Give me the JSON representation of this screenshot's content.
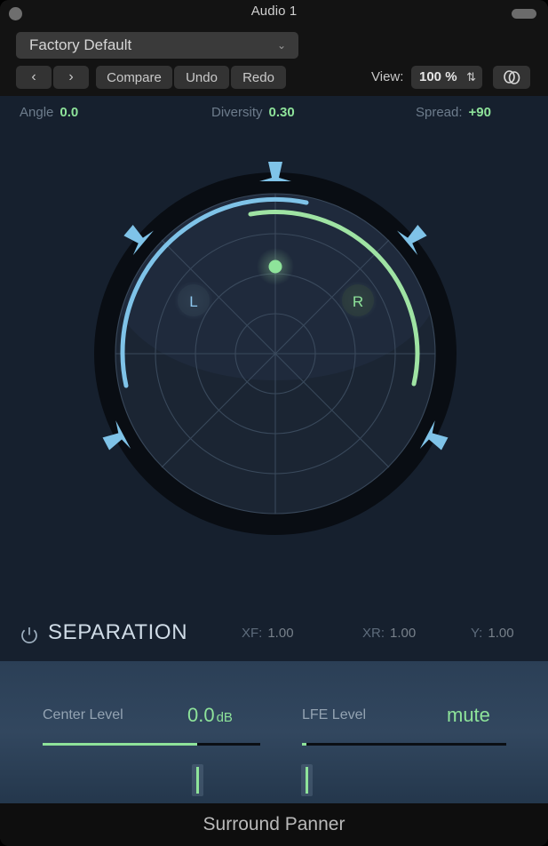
{
  "window": {
    "title": "Audio 1",
    "close_button": "",
    "resize_pill": ""
  },
  "toolbar": {
    "preset": "Factory Default",
    "preset_chevron": "⌄",
    "prev_label": "‹",
    "next_label": "›",
    "compare_label": "Compare",
    "undo_label": "Undo",
    "redo_label": "Redo",
    "view_label": "View:",
    "view_value": "100 %",
    "view_arrows": "⇅",
    "link_icon": "link-icon"
  },
  "params": {
    "angle_name": "Angle",
    "angle_value": "0.0",
    "diversity_name": "Diversity",
    "diversity_value": "0.30",
    "spread_name": "Spread:",
    "spread_value": "+90"
  },
  "radar": {
    "left_marker": "L",
    "right_marker": "R",
    "puck": "puck",
    "speakers": [
      "center",
      "front-left",
      "front-right",
      "surround-left",
      "surround-right"
    ],
    "blue_arc_color": "#7fc3e8",
    "green_arc_color": "#9fe3a3",
    "grid_color": "#3a4a5c",
    "ring_color": "#090d13"
  },
  "separation": {
    "power_icon": "power-icon",
    "title": "SEPARATION",
    "xf_name": "XF:",
    "xf_value": "1.00",
    "xr_name": "XR:",
    "xr_value": "1.00",
    "y_name": "Y:",
    "y_value": "1.00"
  },
  "sliders": {
    "center": {
      "label": "Center Level",
      "value": "0.0",
      "unit": "dB",
      "fill_percent": 71
    },
    "lfe": {
      "label": "LFE Level",
      "value": "mute",
      "unit": "",
      "fill_percent": 2
    }
  },
  "footer": {
    "title": "Surround Panner"
  },
  "colors": {
    "accent_green": "#8ee39a",
    "accent_blue": "#7fc3e8",
    "panel_bg": "#16202e",
    "bottom_bg": "#32475f",
    "chrome_bg": "#131313"
  }
}
